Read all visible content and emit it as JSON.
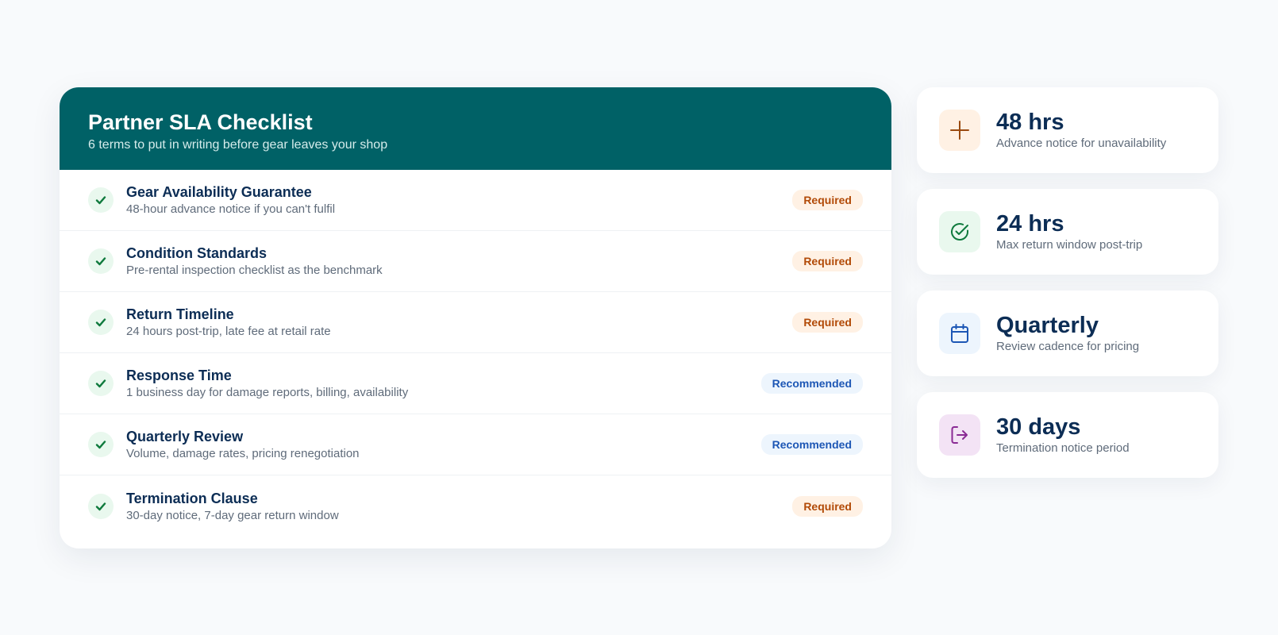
{
  "checklist": {
    "title": "Partner SLA Checklist",
    "subtitle": "6 terms to put in writing before gear leaves your shop",
    "items": [
      {
        "title": "Gear Availability Guarantee",
        "description": "48-hour advance notice if you can't fulfil",
        "badge": "Required"
      },
      {
        "title": "Condition Standards",
        "description": "Pre-rental inspection checklist as the benchmark",
        "badge": "Required"
      },
      {
        "title": "Return Timeline",
        "description": "24 hours post-trip, late fee at retail rate",
        "badge": "Required"
      },
      {
        "title": "Response Time",
        "description": "1 business day for damage reports, billing, availability",
        "badge": "Recommended"
      },
      {
        "title": "Quarterly Review",
        "description": "Volume, damage rates, pricing renegotiation",
        "badge": "Recommended"
      },
      {
        "title": "Termination Clause",
        "description": "30-day notice, 7-day gear return window",
        "badge": "Required"
      }
    ]
  },
  "stats": [
    {
      "value": "48 hrs",
      "label": "Advance notice for unavailability",
      "icon": "plus-icon"
    },
    {
      "value": "24 hrs",
      "label": "Max return window post-trip",
      "icon": "check-circle-icon"
    },
    {
      "value": "Quarterly",
      "label": "Review cadence for pricing",
      "icon": "calendar-icon"
    },
    {
      "value": "30 days",
      "label": "Termination notice period",
      "icon": "exit-icon"
    }
  ],
  "colors": {
    "header_bg": "#006166",
    "required_bg": "#fff1e4",
    "required_text": "#b24a07",
    "recommended_bg": "#edf5fd",
    "recommended_text": "#1d57b5",
    "check_green": "#0f7a3d"
  }
}
